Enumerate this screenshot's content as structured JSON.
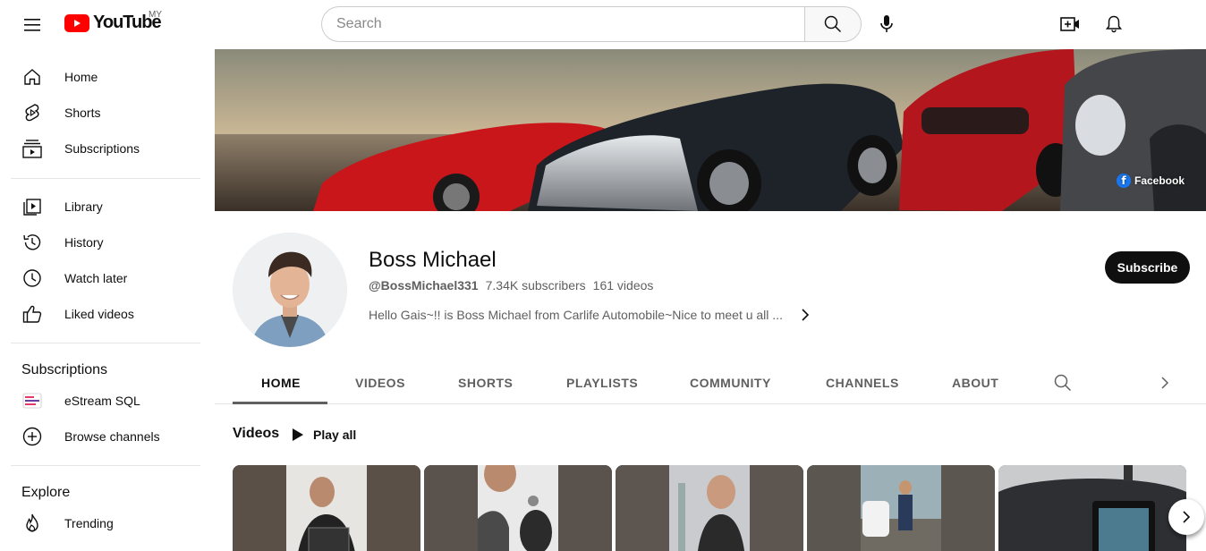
{
  "header": {
    "logo_text": "YouTube",
    "country_code": "MY",
    "search_placeholder": "Search"
  },
  "sidebar": {
    "main": [
      {
        "label": "Home",
        "icon": "home-icon"
      },
      {
        "label": "Shorts",
        "icon": "shorts-icon"
      },
      {
        "label": "Subscriptions",
        "icon": "subscriptions-icon"
      }
    ],
    "you": [
      {
        "label": "Library",
        "icon": "library-icon"
      },
      {
        "label": "History",
        "icon": "history-icon"
      },
      {
        "label": "Watch later",
        "icon": "watch-later-icon"
      },
      {
        "label": "Liked videos",
        "icon": "like-icon"
      }
    ],
    "subscriptions_heading": "Subscriptions",
    "subscriptions": [
      {
        "label": "eStream SQL",
        "icon": "channel-avatar"
      },
      {
        "label": "Browse channels",
        "icon": "add-circle-icon"
      }
    ],
    "explore_heading": "Explore",
    "explore": [
      {
        "label": "Trending",
        "icon": "trending-icon"
      }
    ]
  },
  "banner": {
    "link_label": "Facebook"
  },
  "channel": {
    "name": "Boss Michael",
    "handle": "@BossMichael331",
    "subscribers": "7.34K subscribers",
    "videos": "161 videos",
    "description": "Hello Gais~!! is Boss Michael from Carlife Automobile~Nice to meet u all ...",
    "subscribe_label": "Subscribe"
  },
  "tabs": [
    "HOME",
    "VIDEOS",
    "SHORTS",
    "PLAYLISTS",
    "COMMUNITY",
    "CHANNELS",
    "ABOUT"
  ],
  "active_tab": "HOME",
  "shelf": {
    "title": "Videos",
    "play_all_label": "Play all"
  },
  "colors": {
    "brand_red": "#ff0000",
    "subscribe_bg": "#0f0f0f",
    "facebook_blue": "#1877f2",
    "secondary_text": "#606060"
  }
}
